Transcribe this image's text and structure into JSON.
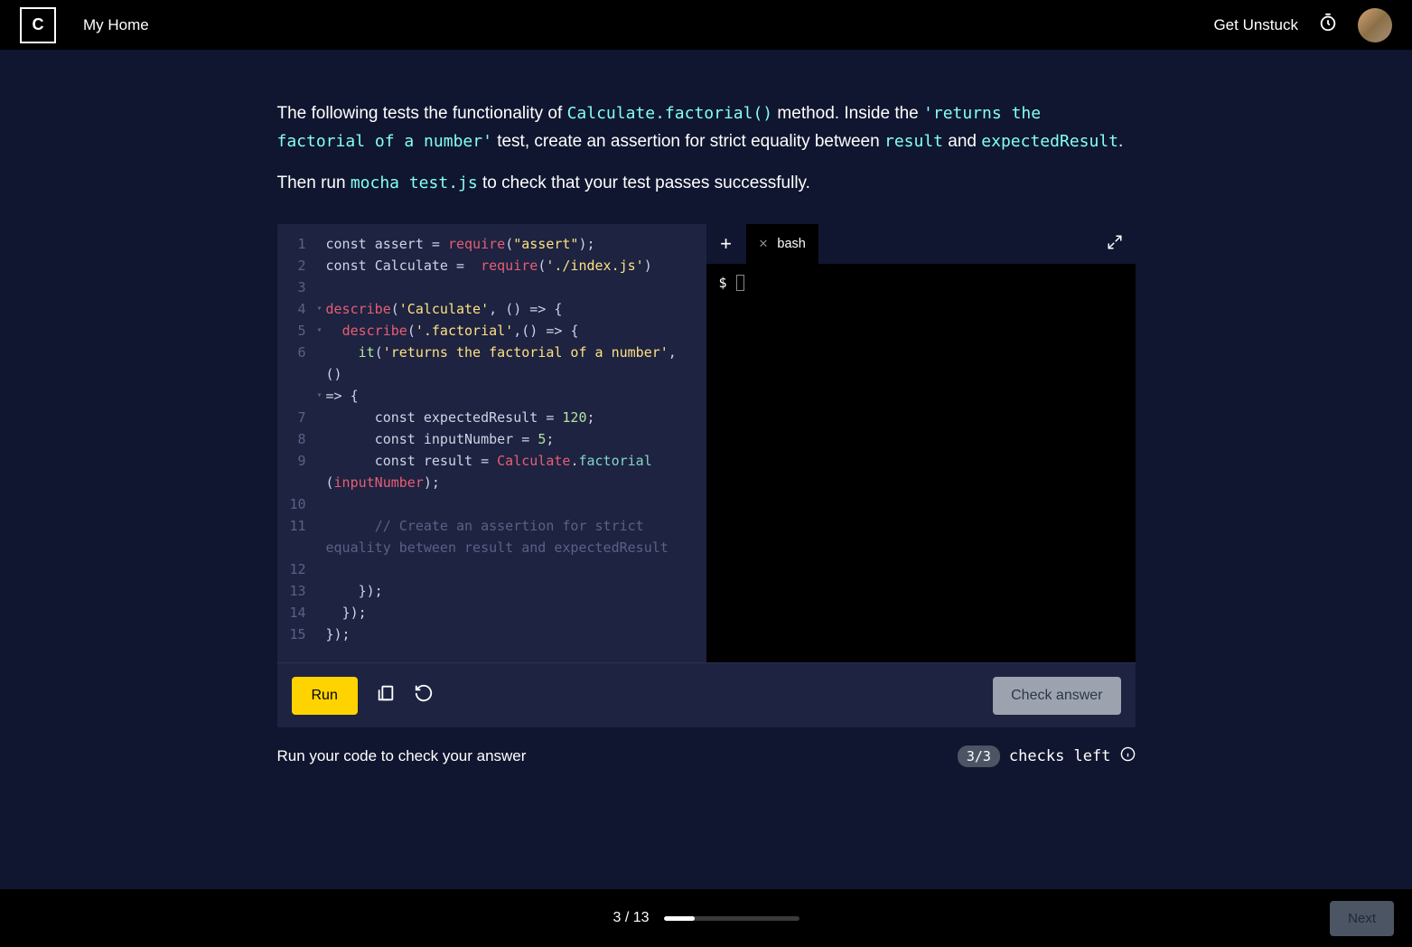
{
  "header": {
    "home_label": "My Home",
    "unstuck_label": "Get Unstuck"
  },
  "instructions": {
    "p1_a": "The following tests the functionality of ",
    "p1_code1": "Calculate.factorial()",
    "p1_b": " method. Inside the ",
    "p1_code2": "'returns the factorial of a number'",
    "p1_c": " test, create an assertion for strict equality between ",
    "p1_code3": "result",
    "p1_d": " and ",
    "p1_code4": "expectedResult",
    "p1_e": ".",
    "p2_a": "Then run ",
    "p2_code1": "mocha test.js",
    "p2_b": " to check that your test passes successfully."
  },
  "editor": {
    "lines": [
      {
        "n": "1",
        "fold": "",
        "html": "<span class='tok-kw'>const</span> <span class='tok-var'>assert</span> <span class='tok-op'>=</span> <span class='tok-fn'>require</span><span class='tok-paren'>(</span><span class='tok-str'>\"assert\"</span><span class='tok-paren'>);</span>"
      },
      {
        "n": "2",
        "fold": "",
        "html": "<span class='tok-kw'>const</span> <span class='tok-var'>Calculate</span> <span class='tok-op'>=</span>  <span class='tok-fn'>require</span><span class='tok-paren'>(</span><span class='tok-str'>'./index.js'</span><span class='tok-paren'>)</span>"
      },
      {
        "n": "3",
        "fold": "",
        "html": ""
      },
      {
        "n": "4",
        "fold": "▾",
        "html": "<span class='tok-fn'>describe</span><span class='tok-paren'>(</span><span class='tok-str'>'Calculate'</span><span class='tok-paren'>,</span> <span class='tok-paren'>()</span> <span class='tok-op'>=&gt;</span> <span class='tok-paren'>{</span>"
      },
      {
        "n": "5",
        "fold": "▾",
        "html": "  <span class='tok-fn'>describe</span><span class='tok-paren'>(</span><span class='tok-str'>'.factorial'</span><span class='tok-paren'>,()</span> <span class='tok-op'>=&gt;</span> <span class='tok-paren'>{</span>"
      },
      {
        "n": "6",
        "fold": "",
        "html": "    <span class='tok-it'>it</span><span class='tok-paren'>(</span><span class='tok-str'>'returns the factorial of a number'</span><span class='tok-paren'>,</span> <span class='tok-paren'>()</span>"
      },
      {
        "n": "",
        "fold": "▾",
        "html": "<span class='tok-op'>=&gt;</span> <span class='tok-paren'>{</span>"
      },
      {
        "n": "7",
        "fold": "",
        "html": "      <span class='tok-kw'>const</span> <span class='tok-var'>expectedResult</span> <span class='tok-op'>=</span> <span class='tok-num'>120</span><span class='tok-paren'>;</span>"
      },
      {
        "n": "8",
        "fold": "",
        "html": "      <span class='tok-kw'>const</span> <span class='tok-var'>inputNumber</span> <span class='tok-op'>=</span> <span class='tok-num'>5</span><span class='tok-paren'>;</span>"
      },
      {
        "n": "9",
        "fold": "",
        "html": "      <span class='tok-kw'>const</span> <span class='tok-var'>result</span> <span class='tok-op'>=</span> <span class='tok-class'>Calculate</span><span class='tok-paren'>.</span><span class='tok-prop'>factorial</span>"
      },
      {
        "n": "",
        "fold": "",
        "html": "<span class='tok-paren'>(</span><span class='tok-param'>inputNumber</span><span class='tok-paren'>);</span>"
      },
      {
        "n": "10",
        "fold": "",
        "html": ""
      },
      {
        "n": "11",
        "fold": "",
        "html": "      <span class='tok-comment'>// Create an assertion for strict</span>"
      },
      {
        "n": "",
        "fold": "",
        "html": "<span class='tok-comment'>equality between result and expectedResult</span>"
      },
      {
        "n": "12",
        "fold": "",
        "html": ""
      },
      {
        "n": "13",
        "fold": "",
        "html": "    <span class='tok-paren'>});</span>"
      },
      {
        "n": "14",
        "fold": "",
        "html": "  <span class='tok-paren'>});</span>"
      },
      {
        "n": "15",
        "fold": "",
        "html": "<span class='tok-paren'>});</span>"
      }
    ]
  },
  "terminal": {
    "tab_label": "bash",
    "prompt": "$"
  },
  "toolbar": {
    "run_label": "Run",
    "check_label": "Check answer"
  },
  "below": {
    "hint": "Run your code to check your answer",
    "checks_badge": "3/3",
    "checks_text": "checks left"
  },
  "footer": {
    "progress_text": "3 / 13",
    "progress_pct": 23,
    "next_label": "Next"
  }
}
